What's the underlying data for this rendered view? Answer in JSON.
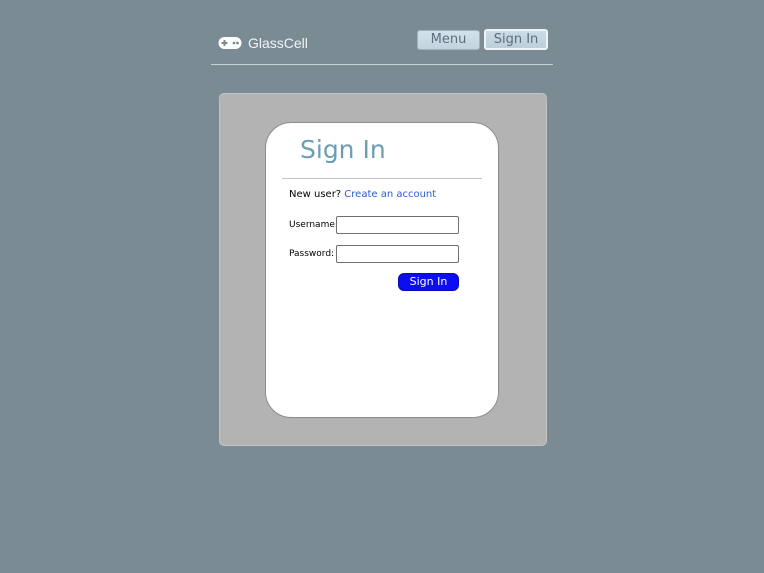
{
  "header": {
    "brand_name": "GlassCell",
    "brand_icon": "gamepad-icon",
    "nav": {
      "menu_label": "Menu",
      "signin_label": "Sign In"
    }
  },
  "signin_card": {
    "title": "Sign In",
    "new_user_prompt": "New user?",
    "create_account_link": "Create an account",
    "username_label": "Username:",
    "username_value": "",
    "password_label": "Password:",
    "password_value": "",
    "submit_label": "Sign In"
  },
  "colors": {
    "page_background": "#7b8b94",
    "panel_background": "#b3b3b3",
    "title_color": "#6b9db4",
    "link_color": "#2b5fcf",
    "submit_button": "#0c0cf5"
  }
}
